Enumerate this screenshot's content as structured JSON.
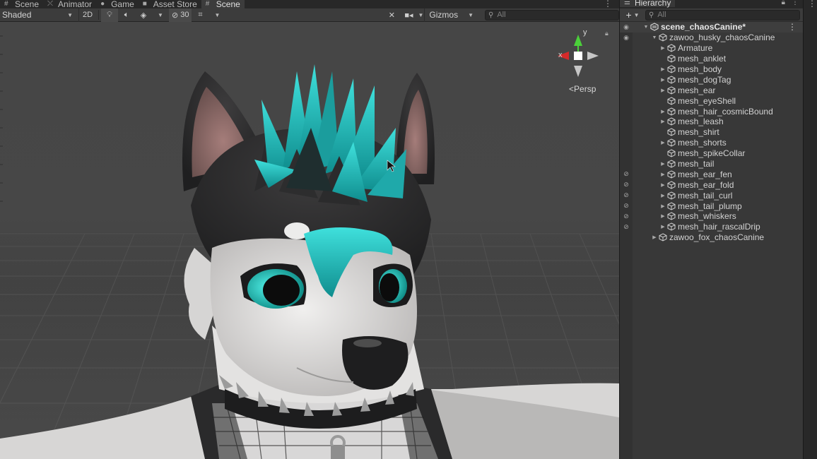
{
  "tabs": [
    {
      "label": "Scene",
      "icon": "grid-icon"
    },
    {
      "label": "Animator",
      "icon": "animator-icon"
    },
    {
      "label": "Game",
      "icon": "gamepad-icon"
    },
    {
      "label": "Asset Store",
      "icon": "store-icon"
    },
    {
      "label": "Scene",
      "icon": "grid-icon",
      "active": true
    }
  ],
  "toolbar": {
    "shading_mode": "Shaded",
    "two_d_label": "2D",
    "hidden_count": "30",
    "gizmos_label": "Gizmos",
    "search_placeholder": "All"
  },
  "viewport": {
    "projection_label": "Persp",
    "axis_x": "x",
    "axis_y": "y"
  },
  "hierarchy": {
    "title": "Hierarchy",
    "search_placeholder": "All",
    "items": [
      {
        "label": "scene_chaosCanine*",
        "depth": 0,
        "type": "scene",
        "expanded": true,
        "eye": true
      },
      {
        "label": "zawoo_husky_chaosCanine",
        "depth": 1,
        "expanded": true,
        "eye": true
      },
      {
        "label": "Armature",
        "depth": 2,
        "arrow": true
      },
      {
        "label": "mesh_anklet",
        "depth": 2
      },
      {
        "label": "mesh_body",
        "depth": 2,
        "arrow": true
      },
      {
        "label": "mesh_dogTag",
        "depth": 2,
        "arrow": true
      },
      {
        "label": "mesh_ear",
        "depth": 2,
        "arrow": true
      },
      {
        "label": "mesh_eyeShell",
        "depth": 2
      },
      {
        "label": "mesh_hair_cosmicBound",
        "depth": 2,
        "arrow": true
      },
      {
        "label": "mesh_leash",
        "depth": 2,
        "arrow": true
      },
      {
        "label": "mesh_shirt",
        "depth": 2
      },
      {
        "label": "mesh_shorts",
        "depth": 2,
        "arrow": true
      },
      {
        "label": "mesh_spikeCollar",
        "depth": 2
      },
      {
        "label": "mesh_tail",
        "depth": 2,
        "arrow": true
      },
      {
        "label": "mesh_ear_fen",
        "depth": 2,
        "arrow": true,
        "hidden": true
      },
      {
        "label": "mesh_ear_fold",
        "depth": 2,
        "arrow": true,
        "hidden": true
      },
      {
        "label": "mesh_tail_curl",
        "depth": 2,
        "arrow": true,
        "hidden": true
      },
      {
        "label": "mesh_tail_plump",
        "depth": 2,
        "arrow": true,
        "hidden": true
      },
      {
        "label": "mesh_whiskers",
        "depth": 2,
        "arrow": true,
        "hidden": true
      },
      {
        "label": "mesh_hair_rascalDrip",
        "depth": 2,
        "arrow": true,
        "hidden": true
      },
      {
        "label": "zawoo_fox_chaosCanine",
        "depth": 1,
        "arrow": true
      }
    ]
  },
  "colors": {
    "teal_hair": "#1fb8b8",
    "gizmo_x": "#d42a2a",
    "gizmo_y": "#4bd03a",
    "panel_bg": "#383838"
  }
}
